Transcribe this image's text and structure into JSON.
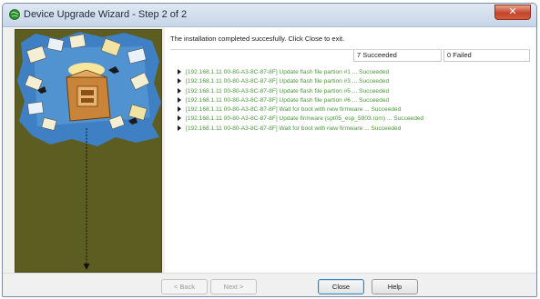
{
  "window": {
    "title": "Device Upgrade Wizard - Step 2 of 2",
    "close_glyph": "✕",
    "app_icon": "green-globe-icon"
  },
  "main": {
    "status_message": "The installation completed succesfully.  Click Close to exit.",
    "succeeded_count": "7 Succeeded",
    "failed_count": "0 Failed",
    "log_entries": [
      "[192.168.1.11 00-80-A3-8C-87-8F] Update flash file partion #1 ... Succeeded",
      "[192.168.1.11 00-80-A3-8C-87-8F] Update flash file partion #3 ... Succeeded",
      "[192.168.1.11 00-80-A3-8C-87-8F] Update flash file partion #5 ... Succeeded",
      "[192.168.1.11 00-80-A3-8C-87-8F] Update flash file partion #6 ... Succeeded",
      "[192.168.1.11 00-80-A3-8C-87-8F] Wait for boot with new firmware ... Succeeded",
      "[192.168.1.11 00-80-A3-8C-87-8F] Update firmware (spt05_esp_5903.rom) ... Succeeded",
      "[192.168.1.11 00-80-A3-8C-87-8F] Wait for boot with new firmware ... Succeeded"
    ],
    "log_color": "#4b9a3c"
  },
  "buttons": {
    "back": "< Back",
    "next": "Next >",
    "close": "Close",
    "help": "Help"
  },
  "colors": {
    "panel_olive": "#5d5d22",
    "title_close": "#c4452a"
  }
}
